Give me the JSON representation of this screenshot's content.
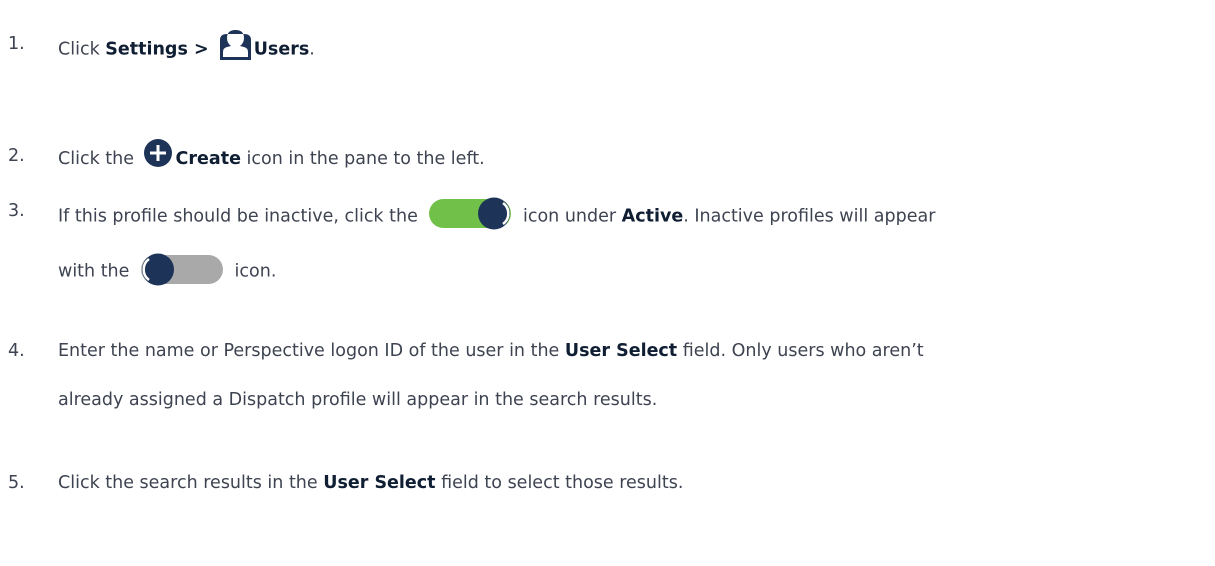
{
  "colors": {
    "text": "#3d4350",
    "bold": "#0f1e33",
    "navy": "#1d3358",
    "toggle_green": "#71c04a",
    "toggle_gray": "#a9a9a9"
  },
  "icons": {
    "users": "user-silhouette-icon",
    "create": "plus-circle-icon",
    "toggle_on": "toggle-on-icon",
    "toggle_off": "toggle-off-icon"
  },
  "steps": [
    {
      "num": "1.",
      "a": "Click ",
      "b": "Settings > ",
      "c": "Users",
      "d": "."
    },
    {
      "num": "2.",
      "a": "Click the ",
      "b": "Create",
      "c": " icon in the pane to the left."
    },
    {
      "num": "3.",
      "a": "If this profile should be inactive, click the ",
      "b": " icon under ",
      "c": "Active",
      "d": ". Inactive profiles will appear",
      "e": "with the ",
      "f": " icon."
    },
    {
      "num": "4.",
      "a": "Enter the name or Perspective logon ID of the user in the ",
      "b": "User Select",
      "c": " field. Only users who aren’t",
      "d": "already assigned a Dispatch profile will appear in the search results."
    },
    {
      "num": "5.",
      "a": "Click the search results in the ",
      "b": "User Select",
      "c": " field to select those results."
    }
  ]
}
